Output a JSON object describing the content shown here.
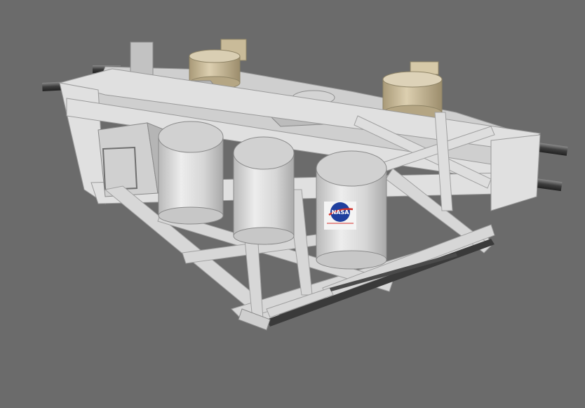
{
  "scene": {
    "background_color": "#6b6b6b",
    "structure_color": "#d9d9d9",
    "tank_color": "#e2e2e2",
    "tan_cylinder_color": "#cdbf9f",
    "logo": {
      "text": "NASA",
      "color": "#1f3f9e",
      "accent": "#d2302a"
    }
  }
}
